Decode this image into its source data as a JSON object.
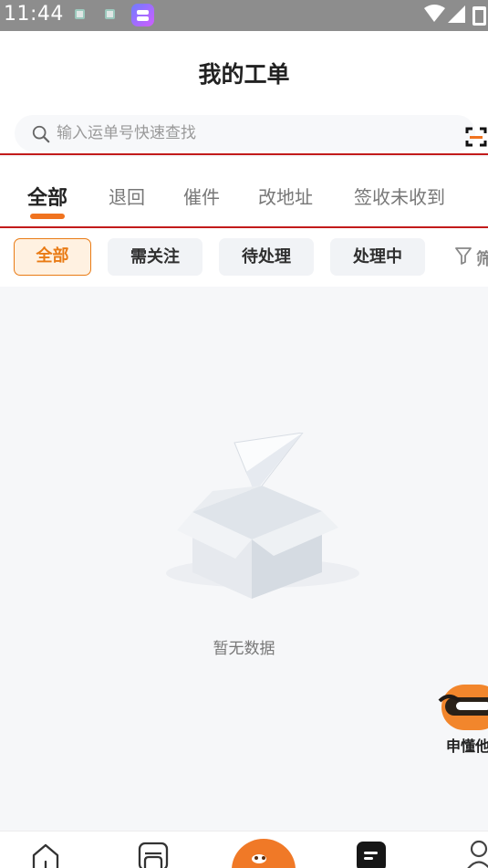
{
  "status_bar": {
    "time": "11:44",
    "icons": [
      "gallery-notification-icon",
      "gallery-notification-icon",
      "app-notification-icon",
      "wifi-icon",
      "cellular-signal-icon",
      "battery-icon"
    ]
  },
  "header": {
    "title": "我的工单"
  },
  "search": {
    "placeholder": "输入运单号快速查找",
    "value": "",
    "scan_icon": "scan-icon"
  },
  "tabs": {
    "items": [
      "全部",
      "退回",
      "催件",
      "改地址",
      "签收未收到"
    ],
    "active_index": 0
  },
  "filters": {
    "items": [
      "全部",
      "需关注",
      "待处理",
      "处理中"
    ],
    "active_index": 0,
    "filter_button_label": "筛"
  },
  "empty_state": {
    "message": "暂无数据"
  },
  "assistant": {
    "label": "申懂他"
  },
  "bottom_nav": {
    "icons": [
      "home-icon",
      "store-icon",
      "assistant-center-icon",
      "work-order-icon",
      "profile-icon"
    ]
  },
  "colors": {
    "accent": "#f0731f",
    "status_bar": "#8d8d8d",
    "background": "#f6f7f9",
    "red_border": "#c21b1b"
  }
}
